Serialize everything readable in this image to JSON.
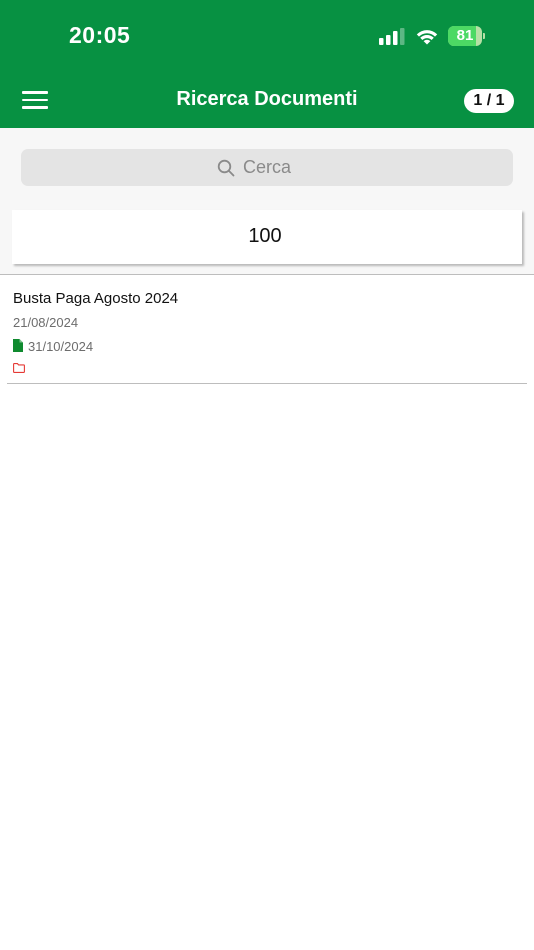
{
  "status_bar": {
    "time": "20:05",
    "battery_percent": 81,
    "battery_label": "81"
  },
  "header": {
    "title": "Ricerca Documenti",
    "pager": "1 / 1",
    "menu_icon": "hamburger-menu-icon"
  },
  "search": {
    "placeholder": "Cerca",
    "icon": "search-icon"
  },
  "result_count": "100",
  "documents": [
    {
      "title": "Busta Paga Agosto 2024",
      "date": "21/08/2024",
      "expiry_date": "31/10/2024",
      "file_icon": "file-icon",
      "folder_icon": "folder-icon"
    }
  ],
  "colors": {
    "header_bg": "#079142",
    "file_icon": "#0f8a2f",
    "folder_icon": "#e53935",
    "battery_fill": "#4cd964"
  }
}
